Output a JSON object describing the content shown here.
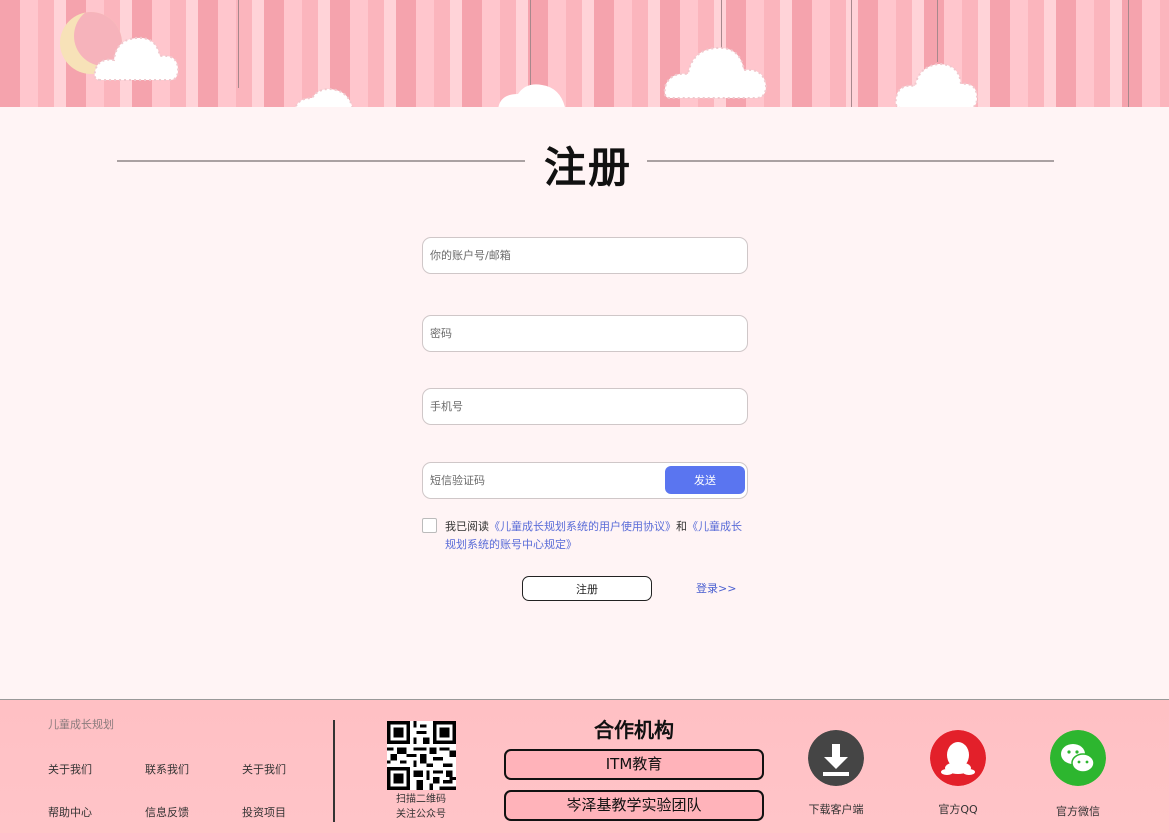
{
  "page": {
    "title": "注册"
  },
  "form": {
    "account_placeholder": "你的账户号/邮箱",
    "password_placeholder": "密码",
    "phone_placeholder": "手机号",
    "sms_placeholder": "短信验证码",
    "send_label": "发送",
    "agree_prefix": "我已阅读",
    "agree_link1": "《儿童成长规划系统的用户使用协议》",
    "agree_and": "和",
    "agree_link2": "《儿童成长规划系统的账号中心规定》",
    "register_label": "注册",
    "login_label": "登录>>"
  },
  "footer": {
    "brand": "儿童成长规划",
    "links": [
      "关于我们",
      "联系我们",
      "关于我们",
      "帮助中心",
      "信息反馈",
      "投资项目"
    ],
    "qr_caption_line1": "扫描二维码",
    "qr_caption_line2": "关注公众号",
    "partners_title": "合作机构",
    "partners": [
      "ITM教育",
      "岑泽基教学实验团队"
    ],
    "download_label": "下载客户端",
    "qq_label": "官方QQ",
    "wechat_label": "官方微信"
  },
  "colors": {
    "accent_blue": "#5a75f0",
    "footer_bg": "#ffc0c4",
    "partner_bg": "#ffb3ba",
    "qq_red": "#e3202a",
    "wechat_green": "#2db62f",
    "download_dark": "#454545"
  },
  "icons": [
    "moon-icon",
    "cloud-icon",
    "qr-code-icon",
    "download-icon",
    "qq-icon",
    "wechat-icon"
  ]
}
